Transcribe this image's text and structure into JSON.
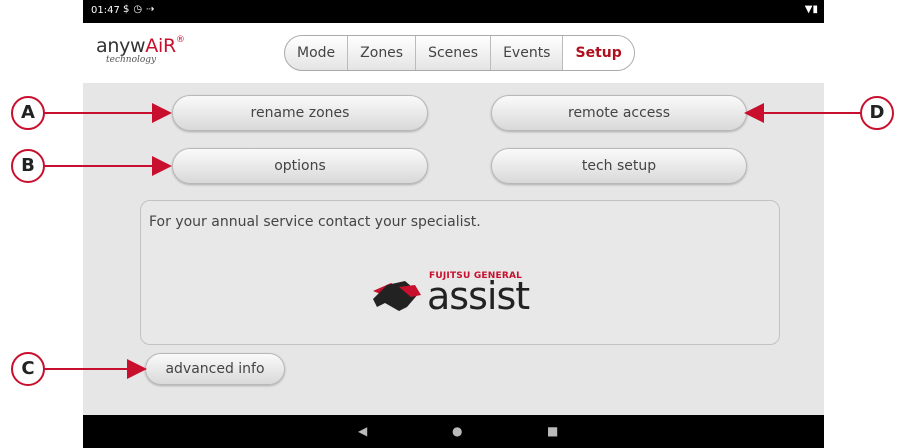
{
  "status_bar": {
    "time": "01:47",
    "left_icons": [
      "sim-icon",
      "clock-icon",
      "signal-icon"
    ],
    "right_icons": [
      "wifi-icon",
      "battery-icon"
    ]
  },
  "logo": {
    "brand_prefix": "anyw",
    "brand_highlight": "AiR",
    "trademark": "®",
    "subtitle": "technology"
  },
  "tabs": [
    {
      "label": "Mode"
    },
    {
      "label": "Zones"
    },
    {
      "label": "Scenes"
    },
    {
      "label": "Events"
    },
    {
      "label": "Setup",
      "active": true
    }
  ],
  "buttons": {
    "rename_zones": "rename zones",
    "remote_access": "remote access",
    "options": "options",
    "tech_setup": "tech setup",
    "advanced_info": "advanced info"
  },
  "info": {
    "message": "For your annual service contact your specialist.",
    "logo_small": "FUJITSU GENERAL",
    "logo_word": "assist"
  },
  "navbar": {
    "back": "◀",
    "home": "●",
    "recents": "■"
  },
  "callouts": {
    "a": "A",
    "b": "B",
    "c": "C",
    "d": "D"
  },
  "colors": {
    "accent": "#c8102e",
    "active_tab": "#b0101e",
    "background": "#e6e6e6"
  }
}
